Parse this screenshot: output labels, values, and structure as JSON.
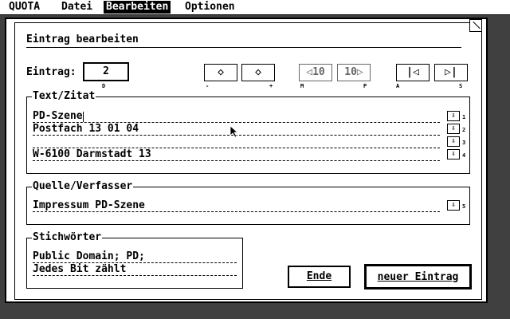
{
  "menubar": {
    "items": [
      "QUOTA",
      "Datei",
      "Bearbeiten",
      "Optionen"
    ],
    "active": "Bearbeiten"
  },
  "dialog": {
    "title": "Eintrag bearbeiten",
    "entry_label": "Eintrag:",
    "entry_value": "2",
    "entry_hint": "D",
    "nav": [
      {
        "label": "◇",
        "hint": "-"
      },
      {
        "label": "◇",
        "hint": "+"
      },
      {
        "label": "◁10",
        "hint": "M"
      },
      {
        "label": "10▷",
        "hint": "P"
      },
      {
        "label": "|◁",
        "hint": "A"
      },
      {
        "label": "▷|",
        "hint": "S"
      }
    ],
    "text_group": {
      "label": "Text/Zitat",
      "lines": [
        "PD-Szene",
        "Postfach 13 01 04",
        "",
        "W-6100 Darmstadt 13"
      ],
      "indices": [
        "1",
        "2",
        "3",
        "4"
      ]
    },
    "source_group": {
      "label": "Quelle/Verfasser",
      "value": "Impressum PD-Szene",
      "index": "5"
    },
    "keywords_group": {
      "label": "Stichwörter",
      "lines": [
        "Public Domain; PD;",
        "Jedes Bit zählt"
      ]
    },
    "buttons": {
      "end": "Ende",
      "new_entry": "neuer Eintrag"
    }
  }
}
